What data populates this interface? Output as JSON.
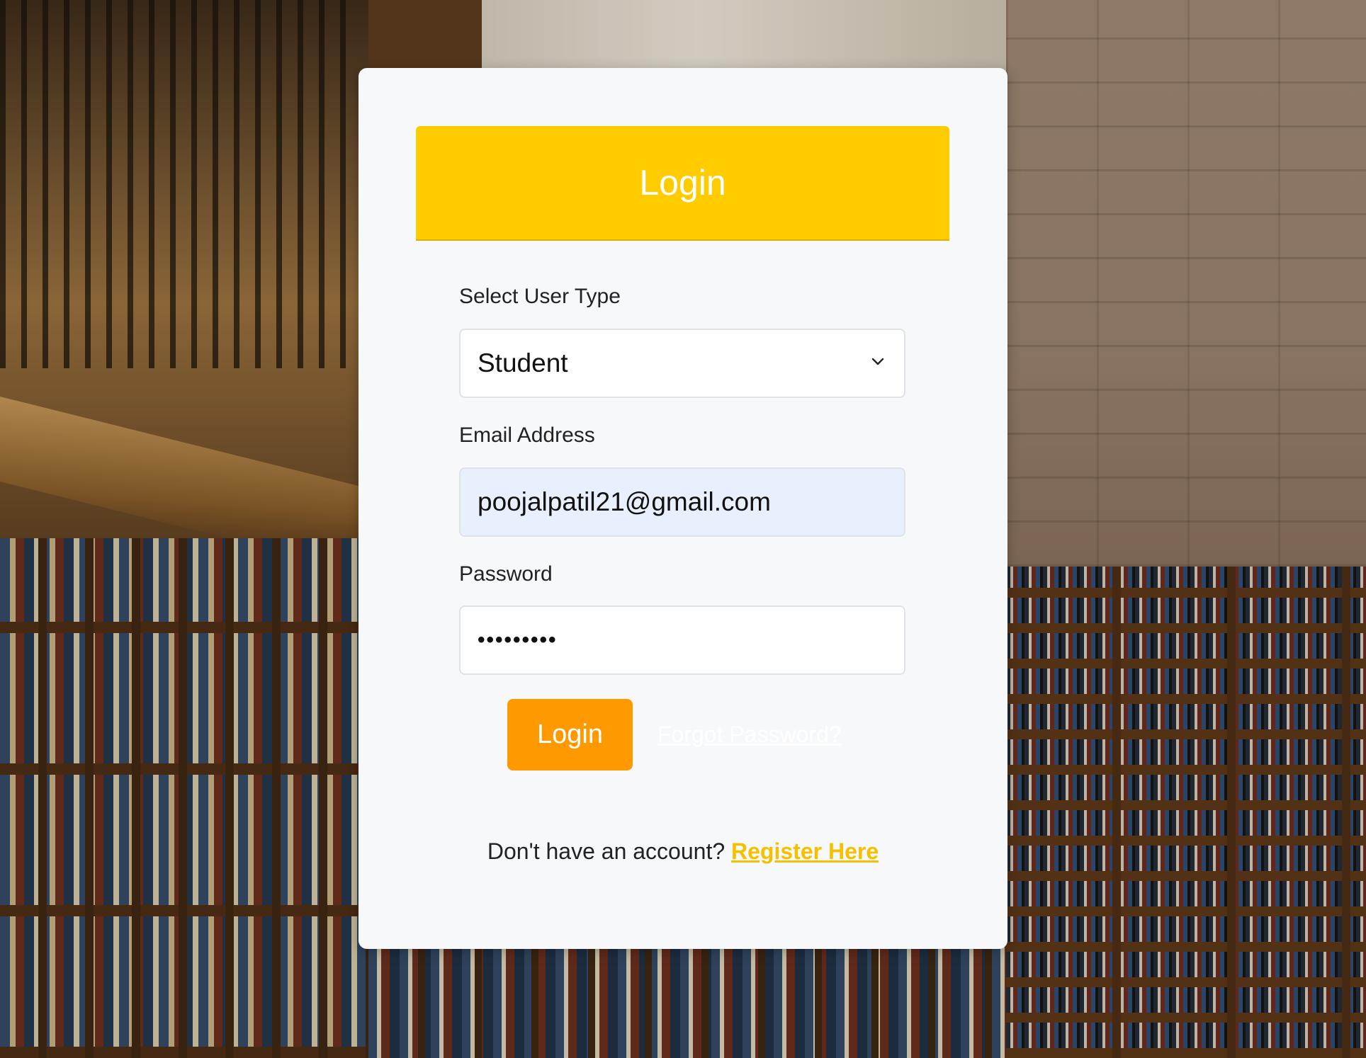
{
  "header": {
    "title": "Login"
  },
  "user_type": {
    "label": "Select User Type",
    "selected": "Student",
    "icon": "chevron-down-icon"
  },
  "email": {
    "label": "Email Address",
    "value": "poojalpatil21@gmail.com"
  },
  "password": {
    "label": "Password",
    "masked_value": "•••••••••"
  },
  "actions": {
    "login_label": "Login",
    "forgot_label": "Forgot Password?"
  },
  "register": {
    "prompt": "Don't have an account?",
    "link_label": "Register Here"
  },
  "colors": {
    "header": "#ffcc00",
    "login_button": "#ff9900",
    "register_link": "#f5c000",
    "email_field_bg": "#e8f0fe"
  }
}
